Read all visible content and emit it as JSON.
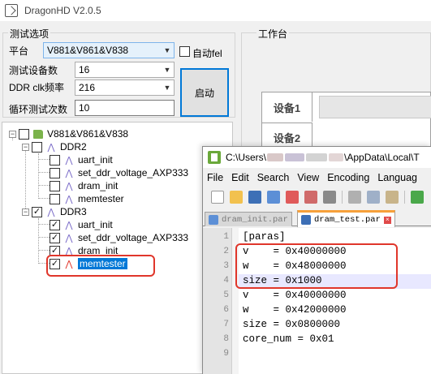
{
  "app": {
    "title": "DragonHD V2.0.5"
  },
  "test_options": {
    "group_title": "测试选项",
    "platform_label": "平台",
    "platform_value": "V881&V861&V838",
    "device_count_label": "测试设备数",
    "device_count_value": "16",
    "ddr_clk_label": "DDR clk频率",
    "ddr_clk_value": "216",
    "loop_label": "循环测试次数",
    "loop_value": "10",
    "autofel_label": "自动fel",
    "start_button": "启动"
  },
  "tree": {
    "root": "V881&V861&V838",
    "groups": [
      {
        "name": "DDR2",
        "checked": false,
        "items": [
          {
            "label": "uart_init",
            "checked": false
          },
          {
            "label": "set_ddr_voltage_AXP333",
            "checked": false
          },
          {
            "label": "dram_init",
            "checked": false
          },
          {
            "label": "memtester",
            "checked": false
          }
        ]
      },
      {
        "name": "DDR3",
        "checked": true,
        "items": [
          {
            "label": "uart_init",
            "checked": true
          },
          {
            "label": "set_ddr_voltage_AXP333",
            "checked": true
          },
          {
            "label": "dram_init",
            "checked": true
          },
          {
            "label": "memtester",
            "checked": true,
            "selected": true
          }
        ]
      }
    ]
  },
  "workbench": {
    "group_title": "工作台",
    "rows": [
      "设备1",
      "设备2"
    ]
  },
  "notepad": {
    "path_prefix": "C:\\Users\\",
    "path_suffix": "\\AppData\\Local\\T",
    "menu": [
      "File",
      "Edit",
      "Search",
      "View",
      "Encoding",
      "Languag"
    ],
    "tabs": [
      {
        "label": "dram_init.par",
        "active": false
      },
      {
        "label": "dram_test.par",
        "active": true
      }
    ],
    "lines": [
      {
        "n": "1",
        "text": "[paras]"
      },
      {
        "n": "2",
        "text": "v    = 0x40000000"
      },
      {
        "n": "3",
        "text": "w    = 0x48000000"
      },
      {
        "n": "4",
        "text": "size = 0x1000"
      },
      {
        "n": "5",
        "text": "v    = 0x40000000"
      },
      {
        "n": "6",
        "text": "w    = 0x42000000"
      },
      {
        "n": "7",
        "text": "size = 0x0800000"
      },
      {
        "n": "8",
        "text": "core_num = 0x01"
      },
      {
        "n": "9",
        "text": ""
      }
    ]
  },
  "colors": {
    "accent": "#0078d7",
    "annotation_red": "#e0362b",
    "tab_orange": "#f7a03a",
    "checkbox_green_icon": "#7bb34b"
  }
}
